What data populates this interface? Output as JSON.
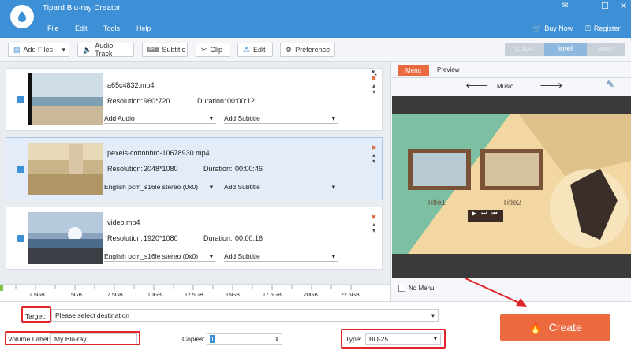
{
  "app": {
    "title": "Tipard Blu-ray Creator",
    "menu": [
      "File",
      "Edit",
      "Tools",
      "Help"
    ],
    "buy_now": "Buy Now",
    "register": "Register"
  },
  "toolbar": {
    "add_files": "Add Files",
    "audio_track": "Audio Track",
    "subtitle": "Subtitle",
    "clip": "Clip",
    "edit": "Edit",
    "preference": "Preference",
    "gpu": [
      "CUDA",
      "intel",
      "AMD"
    ]
  },
  "files": [
    {
      "name": "a65c4832.mp4",
      "resolution_label": "Resolution:",
      "resolution": "960*720",
      "duration_label": "Duration:",
      "duration": "00:00:12",
      "audio": "Add Audio",
      "subtitle": "Add Subtitle"
    },
    {
      "name": "pexels-cottonbro-10678930.mp4",
      "resolution_label": "Resolution:",
      "resolution": "2048*1080",
      "duration_label": "Duration:",
      "duration": "00:00:46",
      "audio": "English pcm_s16le stereo (0x0)",
      "subtitle": "Add Subtitle"
    },
    {
      "name": "video.mp4",
      "resolution_label": "Resolution:",
      "resolution": "1920*1080",
      "duration_label": "Duration:",
      "duration": "00:00:16",
      "audio": "English pcm_s16le stereo (0x0)",
      "subtitle": "Add Subtitle"
    }
  ],
  "ruler": [
    "2.5GB",
    "5GB",
    "7.5GB",
    "10GB",
    "12.5GB",
    "15GB",
    "17.5GB",
    "20GB",
    "22.5GB"
  ],
  "panel": {
    "tabs": [
      "Menu",
      "Preview"
    ],
    "template": "Music",
    "titles": [
      "Title1",
      "Title2"
    ],
    "no_menu": "No Menu"
  },
  "output": {
    "target_label": "Target:",
    "target_placeholder": "Please select destination",
    "volume_label": "Volume Label:",
    "volume_value": "My Blu-ray",
    "copies_label": "Copies:",
    "copies_value": "1",
    "type_label": "Type:",
    "type_value": "BD-25",
    "create": "Create"
  },
  "colors": {
    "titlebar": "#3d8fd6",
    "create": "#ec6a3f",
    "annotation": "#e0262b"
  }
}
